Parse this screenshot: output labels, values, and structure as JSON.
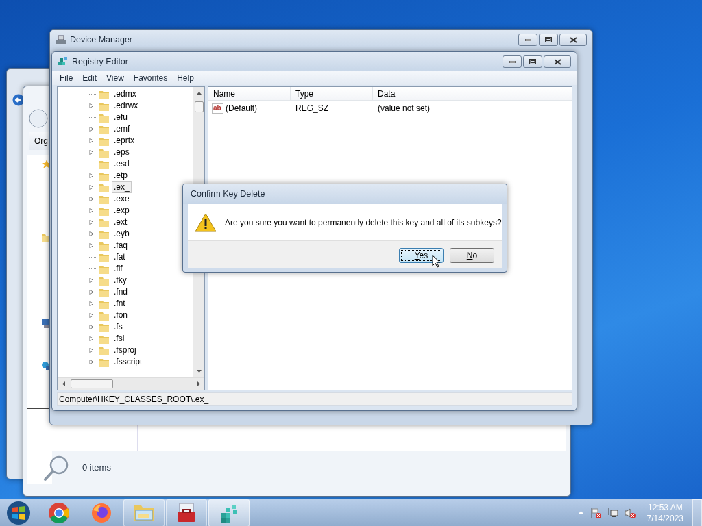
{
  "explorer": {
    "toolbar_text": "Org",
    "status": "0 items"
  },
  "device_manager": {
    "title": "Device Manager"
  },
  "registry_editor": {
    "title": "Registry Editor",
    "menu": [
      "File",
      "Edit",
      "View",
      "Favorites",
      "Help"
    ],
    "tree": [
      {
        "label": ".edmx",
        "expandable": false,
        "selected": false
      },
      {
        "label": ".edrwx",
        "expandable": true,
        "selected": false
      },
      {
        "label": ".efu",
        "expandable": false,
        "selected": false
      },
      {
        "label": ".emf",
        "expandable": true,
        "selected": false
      },
      {
        "label": ".eprtx",
        "expandable": true,
        "selected": false
      },
      {
        "label": ".eps",
        "expandable": true,
        "selected": false
      },
      {
        "label": ".esd",
        "expandable": false,
        "selected": false
      },
      {
        "label": ".etp",
        "expandable": true,
        "selected": false
      },
      {
        "label": ".ex_",
        "expandable": true,
        "selected": true
      },
      {
        "label": ".exe",
        "expandable": true,
        "selected": false
      },
      {
        "label": ".exp",
        "expandable": true,
        "selected": false
      },
      {
        "label": ".ext",
        "expandable": true,
        "selected": false
      },
      {
        "label": ".eyb",
        "expandable": true,
        "selected": false
      },
      {
        "label": ".faq",
        "expandable": true,
        "selected": false
      },
      {
        "label": ".fat",
        "expandable": false,
        "selected": false
      },
      {
        "label": ".fif",
        "expandable": false,
        "selected": false
      },
      {
        "label": ".fky",
        "expandable": true,
        "selected": false
      },
      {
        "label": ".fnd",
        "expandable": true,
        "selected": false
      },
      {
        "label": ".fnt",
        "expandable": true,
        "selected": false
      },
      {
        "label": ".fon",
        "expandable": true,
        "selected": false
      },
      {
        "label": ".fs",
        "expandable": true,
        "selected": false
      },
      {
        "label": ".fsi",
        "expandable": true,
        "selected": false
      },
      {
        "label": ".fsproj",
        "expandable": true,
        "selected": false
      },
      {
        "label": ".fsscript",
        "expandable": true,
        "selected": false
      }
    ],
    "list": {
      "columns": [
        "Name",
        "Type",
        "Data"
      ],
      "rows": [
        {
          "icon_text": "ab",
          "name": "(Default)",
          "type": "REG_SZ",
          "data": "(value not set)"
        }
      ]
    },
    "status_bar": "Computer\\HKEY_CLASSES_ROOT\\.ex_"
  },
  "dialog": {
    "title": "Confirm Key Delete",
    "message": "Are you sure you want to permanently delete this key and all of its subkeys?",
    "buttons": [
      {
        "label": "Yes",
        "focused": true
      },
      {
        "label": "No",
        "focused": false
      }
    ]
  },
  "taskbar": {
    "apps": [
      {
        "kind": "chrome",
        "open": false,
        "selected": false
      },
      {
        "kind": "firefox",
        "open": false,
        "selected": false
      },
      {
        "kind": "explorer",
        "open": true,
        "selected": false
      },
      {
        "kind": "toolbox",
        "open": true,
        "selected": false
      },
      {
        "kind": "registry",
        "open": true,
        "selected": true
      }
    ],
    "clock": {
      "time": "12:53 AM",
      "date": "7/14/2023"
    }
  }
}
